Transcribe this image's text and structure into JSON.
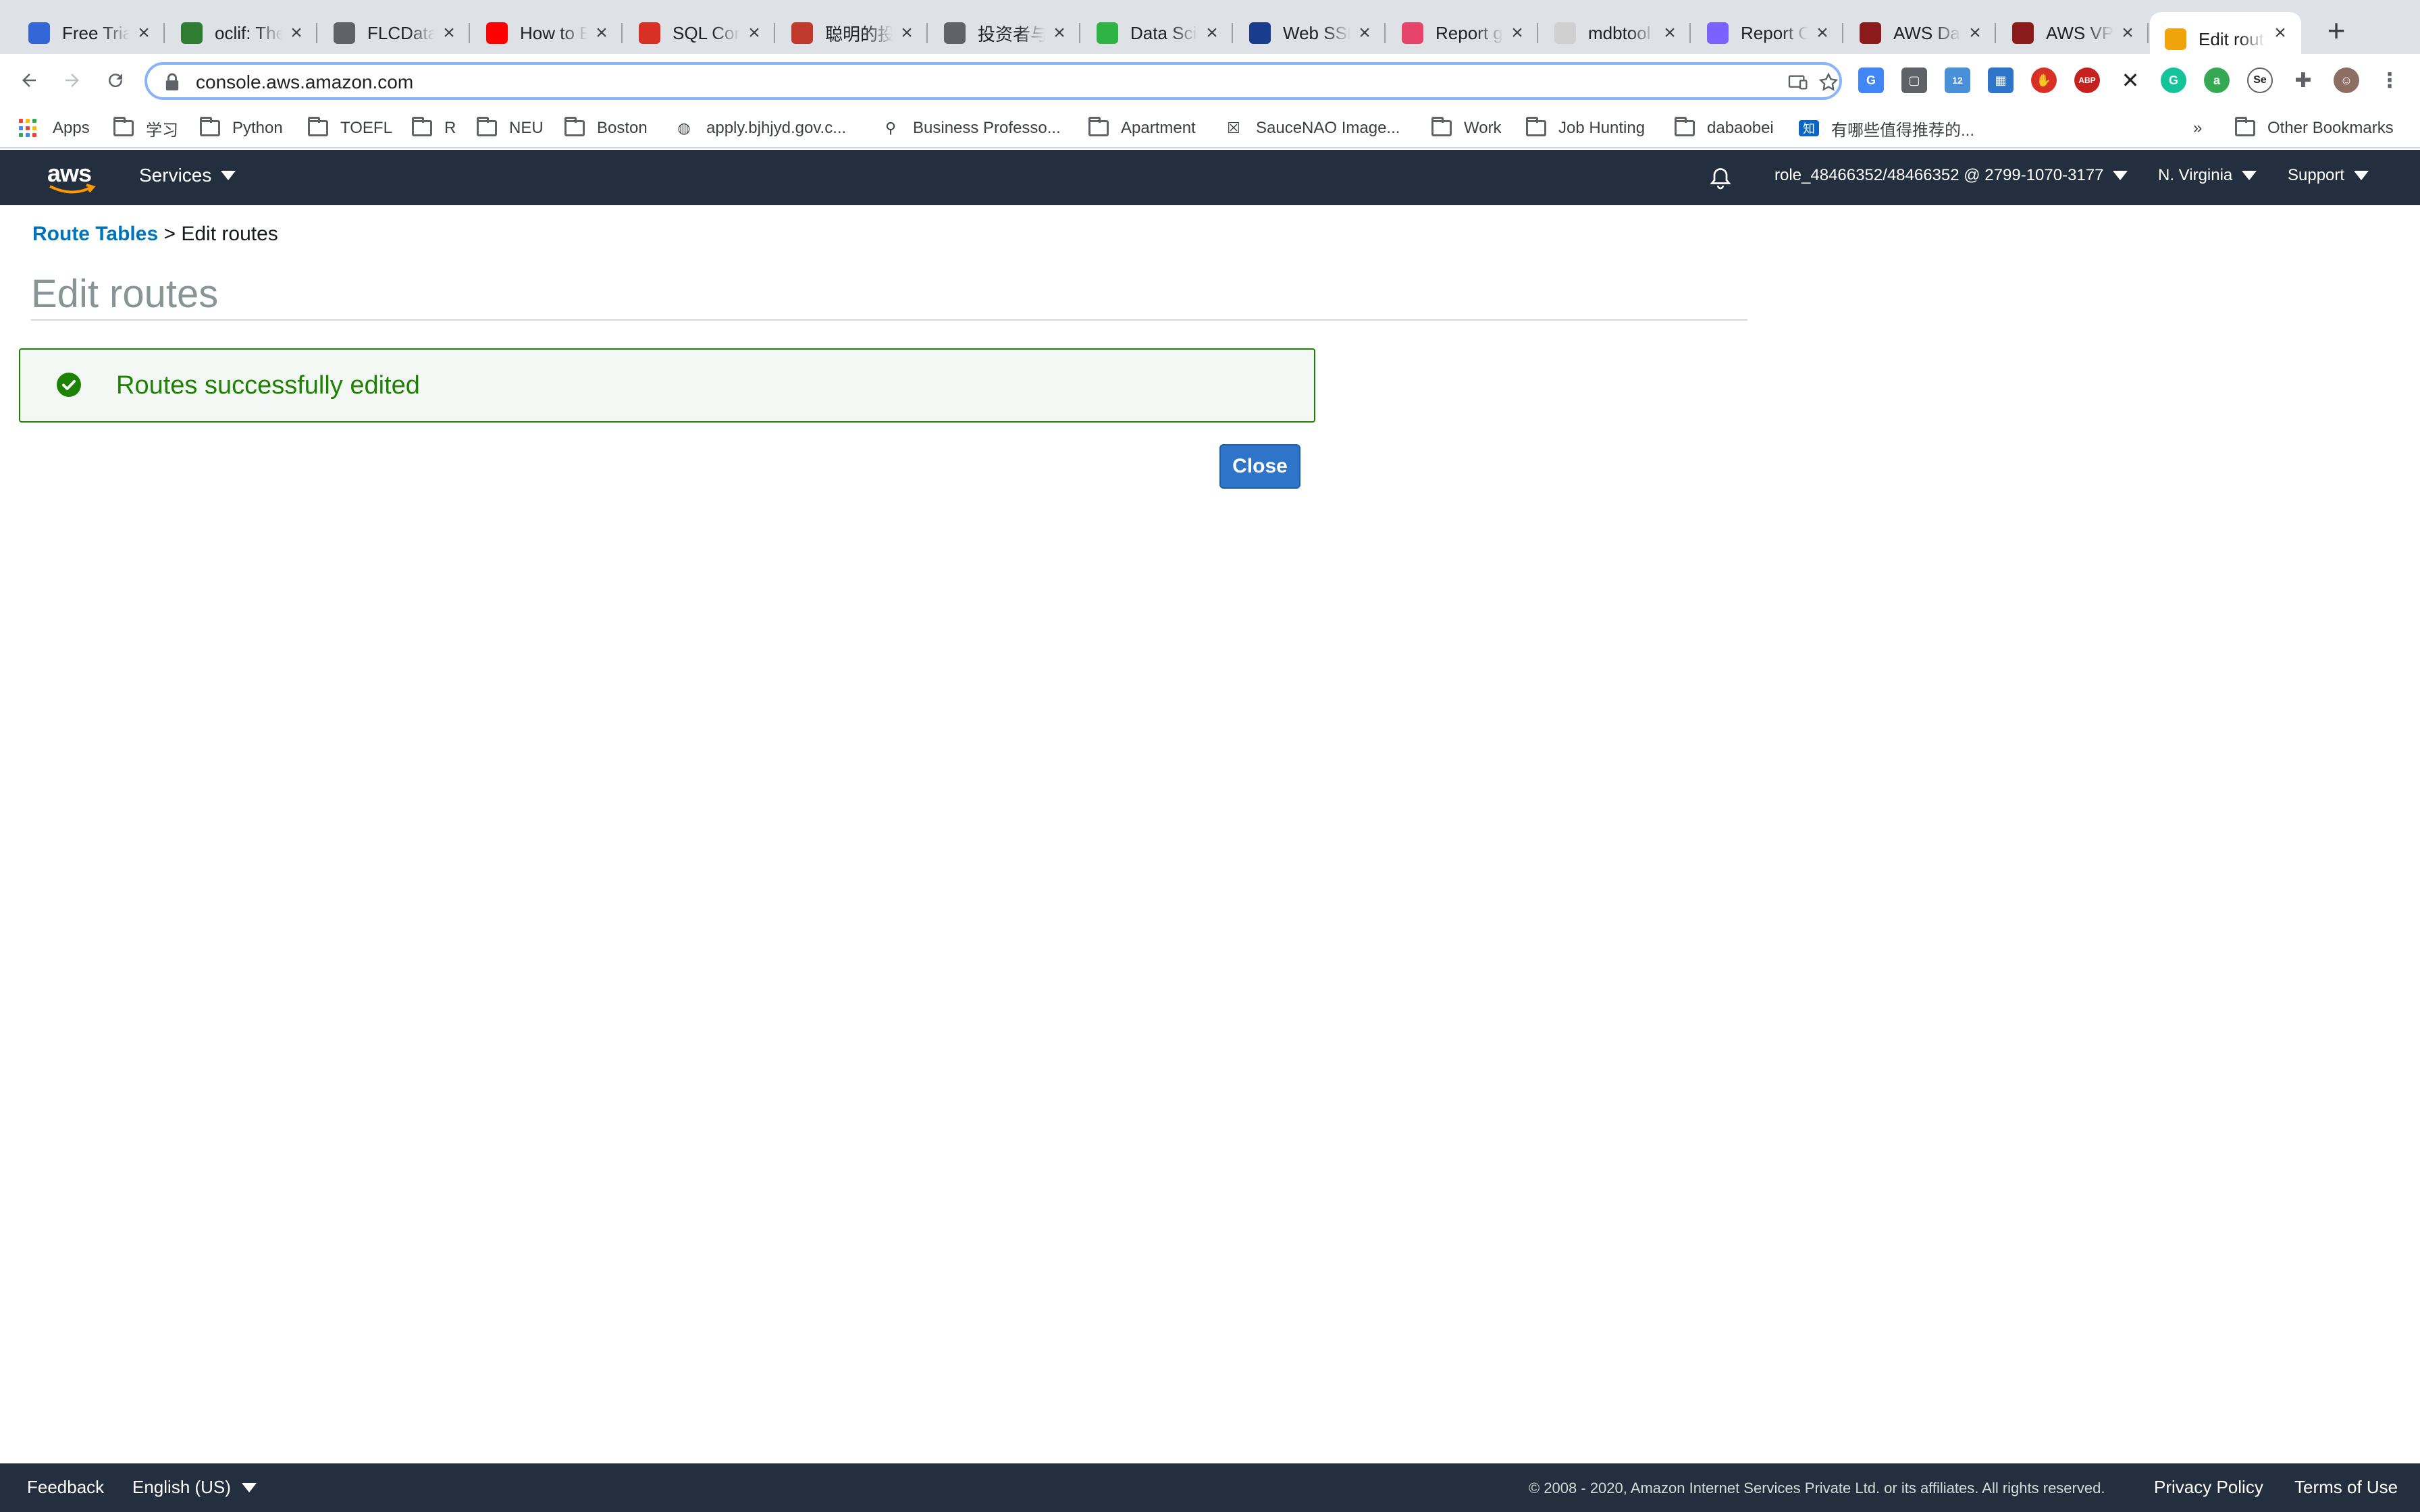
{
  "browser": {
    "tabs": [
      {
        "title": "Free Trial",
        "icon": "circle-c-icon",
        "color": "#3367d6"
      },
      {
        "title": "oclif: The",
        "icon": "oclif-icon",
        "color": "#2e7d32"
      },
      {
        "title": "FLCData",
        "icon": "globe-icon",
        "color": "#5f6368"
      },
      {
        "title": "How to E",
        "icon": "youtube-icon",
        "color": "#ff0000"
      },
      {
        "title": "SQL Con",
        "icon": "sql-icon",
        "color": "#d93025"
      },
      {
        "title": "聪明的投",
        "icon": "bull-icon",
        "color": "#c0392b"
      },
      {
        "title": "投资者与",
        "icon": "globe-icon",
        "color": "#5f6368"
      },
      {
        "title": "Data Sci",
        "icon": "rc-icon",
        "color": "#2fb344"
      },
      {
        "title": "Web SSF",
        "icon": "check-doc-icon",
        "color": "#1a3c8c"
      },
      {
        "title": "Report g",
        "icon": "report-icon",
        "color": "#e8446b"
      },
      {
        "title": "mdbtool",
        "icon": "github-icon",
        "color": "#d0d0d0"
      },
      {
        "title": "Report C",
        "icon": "pinwheel-icon",
        "color": "#7b61ff"
      },
      {
        "title": "AWS Dat",
        "icon": "aws-video-icon",
        "color": "#8b1a1a"
      },
      {
        "title": "AWS VP",
        "icon": "aws-video-icon",
        "color": "#8b1a1a"
      },
      {
        "title": "Edit rout",
        "icon": "aws-cube-icon",
        "color": "#f0a30a",
        "active": true
      }
    ],
    "url": "console.aws.amazon.com",
    "bookmarks": [
      {
        "label": "Apps",
        "type": "apps"
      },
      {
        "label": "学习",
        "type": "folder"
      },
      {
        "label": "Python",
        "type": "folder"
      },
      {
        "label": "TOEFL",
        "type": "folder"
      },
      {
        "label": "R",
        "type": "folder"
      },
      {
        "label": "NEU",
        "type": "folder"
      },
      {
        "label": "Boston",
        "type": "folder"
      },
      {
        "label": "apply.bjhjyd.gov.c...",
        "type": "globe"
      },
      {
        "label": "Business Professo...",
        "type": "person"
      },
      {
        "label": "Apartment",
        "type": "folder"
      },
      {
        "label": "SauceNAO Image...",
        "type": "x"
      },
      {
        "label": "Work",
        "type": "folder"
      },
      {
        "label": "Job Hunting",
        "type": "folder"
      },
      {
        "label": "dabaobei",
        "type": "folder"
      },
      {
        "label": "有哪些值得推荐的...",
        "type": "zhihu"
      }
    ],
    "overflow": "»",
    "other_bookmarks": "Other Bookmarks"
  },
  "aws": {
    "logo": "aws",
    "services": "Services",
    "account": "role_48466352/48466352 @ 2799-1070-3177",
    "region": "N. Virginia",
    "support": "Support"
  },
  "page": {
    "breadcrumb_link": "Route Tables",
    "breadcrumb_sep": ">",
    "breadcrumb_current": "Edit routes",
    "title": "Edit routes",
    "alert": "Routes successfully edited",
    "close": "Close"
  },
  "footer": {
    "feedback": "Feedback",
    "language": "English (US)",
    "copyright": "© 2008 - 2020, Amazon Internet Services Private Ltd. or its affiliates. All rights reserved.",
    "privacy": "Privacy Policy",
    "terms": "Terms of Use"
  },
  "colors": {
    "aws_navy": "#232f3e",
    "link_blue": "#0073bb",
    "success_green": "#1d8102",
    "button_blue": "#2e74c8"
  }
}
